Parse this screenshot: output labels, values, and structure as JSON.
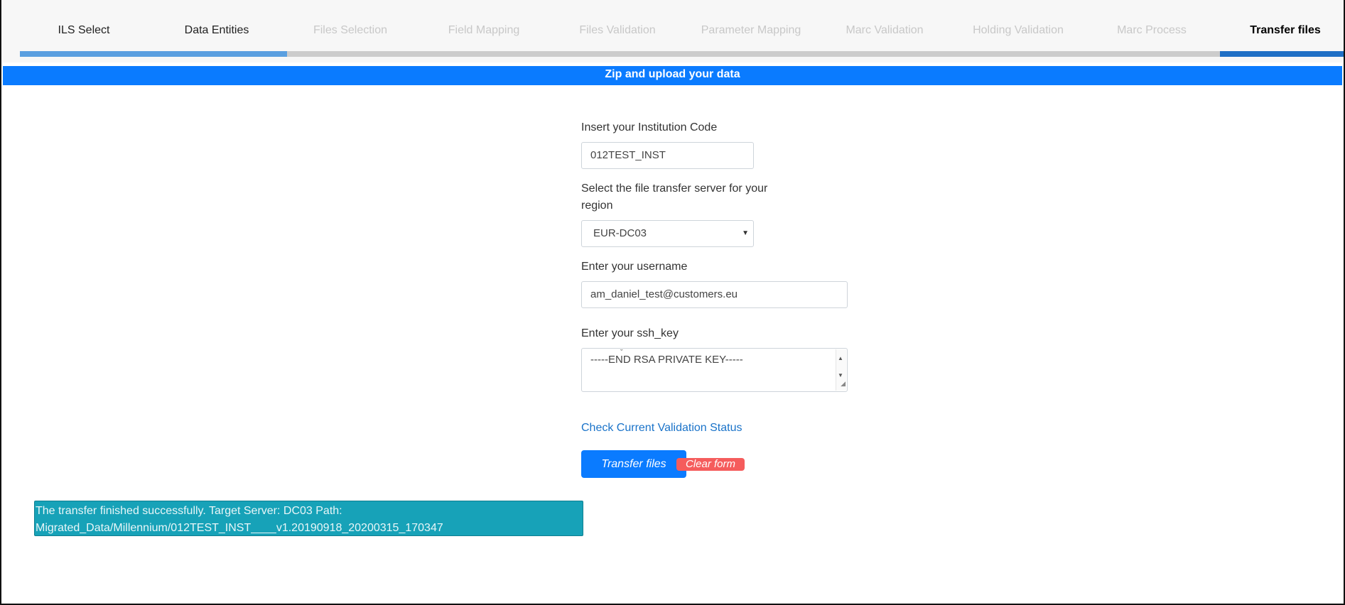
{
  "steps": [
    {
      "label": "ILS Select",
      "state": "done"
    },
    {
      "label": "Data Entities",
      "state": "done"
    },
    {
      "label": "Files Selection",
      "state": "pending"
    },
    {
      "label": "Field Mapping",
      "state": "pending"
    },
    {
      "label": "Files Validation",
      "state": "pending"
    },
    {
      "label": "Parameter Mapping",
      "state": "pending"
    },
    {
      "label": "Marc Validation",
      "state": "pending"
    },
    {
      "label": "Holding Validation",
      "state": "pending"
    },
    {
      "label": "Marc Process",
      "state": "pending"
    },
    {
      "label": "Transfer files",
      "state": "active"
    }
  ],
  "banner": {
    "title": "Zip and upload your data"
  },
  "form": {
    "institution_label": "Insert your Institution Code",
    "institution_value": "012TEST_INST",
    "server_label_line1": "Select the file transfer server for your",
    "server_label_line2": "region",
    "server_value": "EUR-DC03",
    "username_label": "Enter your username",
    "username_value": "am_daniel_test@customers.eu",
    "sshkey_label": "Enter your ssh_key",
    "sshkey_value": "-----END RSA PRIVATE KEY-----"
  },
  "actions": {
    "check_status_link": "Check Current Validation Status",
    "transfer_button": "Transfer files",
    "clear_button": "Clear form"
  },
  "alert": {
    "line1": "The transfer finished successfully. Target Server: DC03 Path:",
    "line2": "Migrated_Data/Millennium/012TEST_INST____v1.20190918_20200315_170347"
  },
  "colors": {
    "primary": "#0a7bff",
    "danger": "#f55c5c",
    "info": "#17a2b8",
    "link": "#1a73c9"
  }
}
